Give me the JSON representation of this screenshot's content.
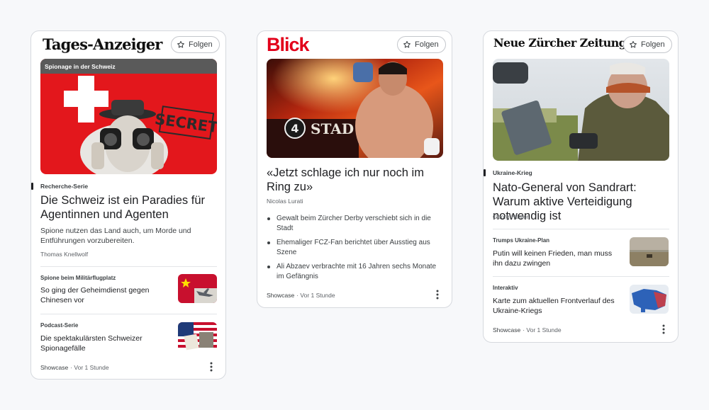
{
  "follow_label": "Folgen",
  "cards": [
    {
      "logo": "Tages-Anzeiger",
      "image_caption": "Spionage in der Schweiz",
      "kicker": "Recherche-Serie",
      "headline": "Die Schweiz ist ein Paradies für Agentinnen und Agenten",
      "description": "Spione nutzen das Land auch, um Morde und Entführungen vorzubereiten.",
      "author": "Thomas Knellwolf",
      "related": [
        {
          "kicker": "Spione beim Militärflugplatz",
          "title": "So ging der Geheimdienst gegen Chinesen vor",
          "thumb_icon": "china-flag-jet-thumbnail"
        },
        {
          "kicker": "Podcast-Serie",
          "title": "Die spektakulärsten Schweizer Spionagefälle",
          "thumb_icon": "usa-flag-collage-thumbnail"
        }
      ],
      "footer_source": "Showcase",
      "footer_time": "· Vor 1 Stunde"
    },
    {
      "logo": "Blick",
      "headline": "«Jetzt schlage ich nur noch im Ring zu»",
      "author": "Nicolas Lurati",
      "bullets": [
        "Gewalt beim Zürcher Derby verschiebt sich in die Stadt",
        "Ehemaliger FCZ-Fan berichtet über  Ausstieg aus Szene",
        "Ali Abzaev verbrachte mit 16 Jahren sechs Monate im Gefängnis"
      ],
      "image_text": "STAD",
      "footer_source": "Showcase",
      "footer_time": "· Vor 1 Stunde"
    },
    {
      "logo": "Neue Zürcher Zeitung",
      "kicker": "Ukraine-Krieg",
      "headline": "Nato-General von Sandrart: Warum aktive Verteidigung notwendig ist",
      "author": "Georg Häsler",
      "related": [
        {
          "kicker": "Trumps Ukraine-Plan",
          "title": "Putin will keinen Frieden, man muss ihn dazu zwingen",
          "thumb_icon": "field-landscape-thumbnail"
        },
        {
          "kicker": "Interaktiv",
          "title": "Karte zum aktuellen Frontverlauf des Ukraine-Kriegs",
          "thumb_icon": "ukraine-map-thumbnail"
        }
      ],
      "footer_source": "Showcase",
      "footer_time": "· Vor 1 Stunde"
    }
  ],
  "colors": {
    "blick_red": "#e2001a",
    "swiss_red": "#e3171c",
    "ukraine_blue": "#2d62b8",
    "text": "#202124"
  }
}
